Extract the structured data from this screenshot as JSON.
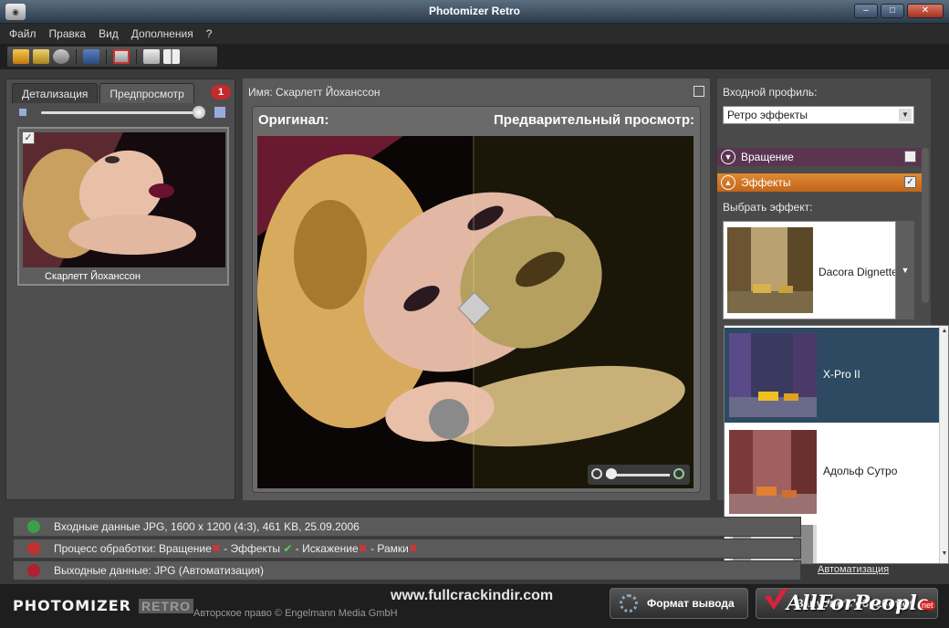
{
  "window": {
    "title": "Photomizer Retro",
    "app_icon": "photo-icon"
  },
  "menu": [
    "Файл",
    "Правка",
    "Вид",
    "Дополнения",
    "?"
  ],
  "left": {
    "tabs": [
      "Детализация",
      "Предпросмотр"
    ],
    "badge": "1",
    "thumb_label": "Скарлетт Йоханссон",
    "thumb_checked": "✓"
  },
  "center": {
    "name_label": "Имя: Скарлетт Йоханссон",
    "original_label": "Оригинал:",
    "preview_label": "Предварительный просмотр:"
  },
  "right": {
    "profile_label": "Входной профиль:",
    "profile_value": "Ретро эффекты",
    "section_rotation": "Вращение",
    "section_effects": "Эффекты",
    "effects_checked": "✓",
    "pick_label": "Выбрать эффект:",
    "selected_effect": "Dacora Dignette"
  },
  "dropdown": {
    "items": [
      "X-Pro II",
      "Адольф Сутро",
      ""
    ],
    "selected_index": 0
  },
  "info": {
    "input": "Входные данные JPG, 1600 x 1200 (4:3), 461 KB, 25.09.2006",
    "process_prefix": "Процесс обработки: Вращение",
    "process_effects": " - Эффекты",
    "process_distort": " - Искажение",
    "process_frames": " - Рамки",
    "output": "Выходные данные: JPG (Автоматизация)",
    "auto_link": "Автоматизация"
  },
  "bottom": {
    "brand": "PHOTOMIZER",
    "brand_retro": "RETRO",
    "copyright": "Авторское право © Engelmann Media GmbH",
    "site": "www.fullcrackindir.com",
    "format_button": "Формат вывода",
    "go_button": "Запустить обработку",
    "watermark": "AllForPeople",
    "watermark_net": "net"
  }
}
